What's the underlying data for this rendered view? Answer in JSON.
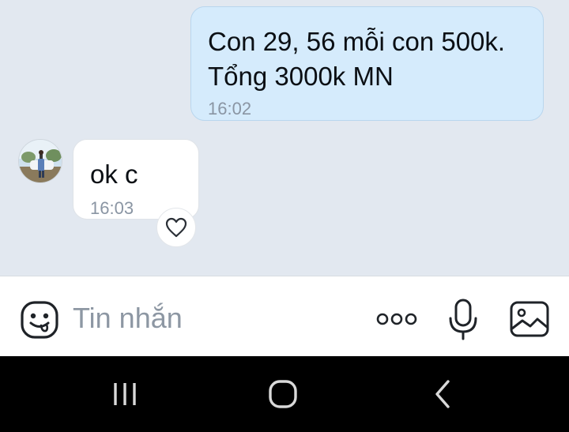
{
  "messages": [
    {
      "direction": "outgoing",
      "text": "Con 29, 56 mỗi con 500k.\nTổng 3000k MN",
      "time": "16:02"
    },
    {
      "direction": "incoming",
      "text": "ok c",
      "time": "16:03"
    }
  ],
  "composer": {
    "placeholder": "Tin nhắn"
  },
  "icons": {
    "reaction": "heart-outline-icon",
    "emoji": "emoji-face-icon",
    "more": "more-dots-icon",
    "mic": "microphone-icon",
    "image": "image-gallery-icon",
    "nav_recents": "recents-icon",
    "nav_home": "home-icon",
    "nav_back": "back-icon"
  },
  "colors": {
    "chat_background": "#e2e8f0",
    "outgoing_bubble": "#d5ebfc",
    "incoming_bubble": "#ffffff",
    "timestamp": "#8a95a3",
    "navbar": "#000000"
  }
}
